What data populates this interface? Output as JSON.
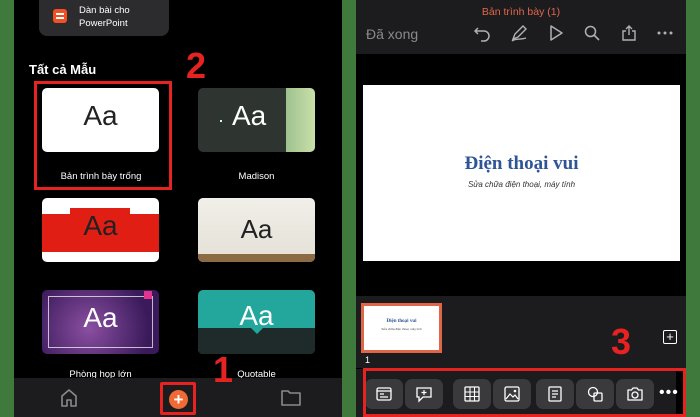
{
  "left": {
    "outline_card": "Dàn bài cho PowerPoint",
    "section_title": "Tất cả Mẫu",
    "templates": [
      {
        "label": "Bản trình bày trống",
        "preview": "Aa"
      },
      {
        "label": "Madison",
        "preview": "Aa"
      },
      {
        "label": "",
        "preview": "Aa"
      },
      {
        "label": "",
        "preview": "Aa"
      },
      {
        "label": "Phòng họp lớn",
        "preview": "Aa"
      },
      {
        "label": "Quotable",
        "preview": "Aa"
      }
    ],
    "nav": {
      "home_icon": "home-icon",
      "new_icon": "plus-icon",
      "new_symbol": "+",
      "folder_icon": "folder-icon"
    }
  },
  "right": {
    "doc_title": "Bản trình bày (1)",
    "done_label": "Đã xong",
    "toolbar_icons": [
      "undo-icon",
      "pen-icon",
      "play-icon",
      "search-icon",
      "share-icon",
      "more-icon"
    ],
    "slide": {
      "title": "Điện thoại vui",
      "subtitle": "Sửa chữa điện thoại, máy tính"
    },
    "slide_number": "1",
    "add_symbol": "+",
    "insert_toolbar": [
      "layout-icon",
      "comment-icon",
      "table-icon",
      "picture-icon",
      "textbox-icon",
      "shapes-icon",
      "camera-icon",
      "more-icon"
    ],
    "more_symbol": "•••"
  },
  "annotations": {
    "step1": "1",
    "step2": "2",
    "step3": "3",
    "highlight_color": "#e62321"
  },
  "colors": {
    "background": "#3f7a3c",
    "accent": "#e0664a",
    "slide_title": "#2f5597"
  }
}
